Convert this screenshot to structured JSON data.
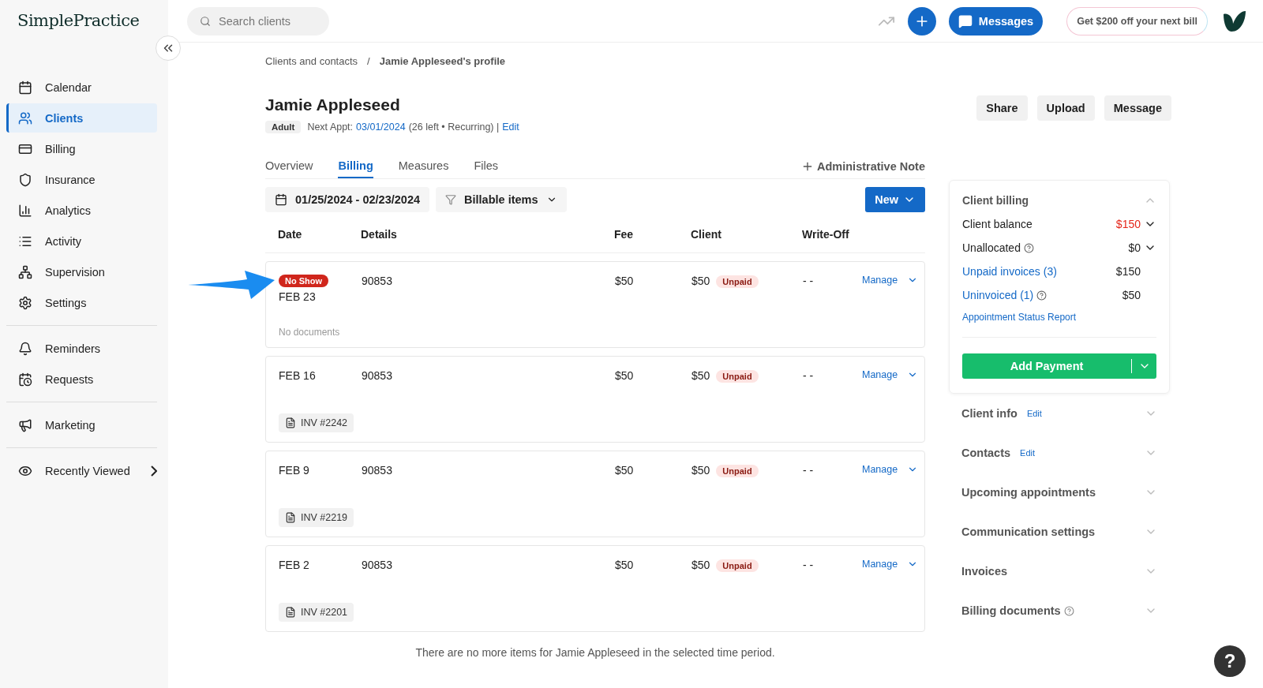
{
  "logo": "SimplePractice",
  "search": {
    "placeholder": "Search clients"
  },
  "header": {
    "messages": "Messages",
    "promo": "Get $200 off your next bill"
  },
  "sidebar": {
    "groups": [
      {
        "items": [
          {
            "label": "Calendar",
            "selected": false,
            "kind": "link"
          },
          {
            "label": "Clients",
            "selected": true,
            "kind": "link"
          },
          {
            "label": "Billing",
            "selected": false,
            "kind": "link"
          },
          {
            "label": "Insurance",
            "selected": false,
            "kind": "link"
          },
          {
            "label": "Analytics",
            "selected": false,
            "kind": "link"
          },
          {
            "label": "Activity",
            "selected": false,
            "kind": "link"
          },
          {
            "label": "Supervision",
            "selected": false,
            "kind": "link"
          },
          {
            "label": "Settings",
            "selected": false,
            "kind": "link"
          }
        ]
      },
      {
        "items": [
          {
            "label": "Reminders",
            "selected": false,
            "kind": "link"
          },
          {
            "label": "Requests",
            "selected": false,
            "kind": "link"
          }
        ]
      },
      {
        "items": [
          {
            "label": "Marketing",
            "selected": false,
            "kind": "link"
          }
        ]
      },
      {
        "items": [
          {
            "label": "Recently Viewed",
            "selected": false,
            "kind": "expand"
          }
        ]
      }
    ]
  },
  "breadcrumb": {
    "items": [
      "Clients and contacts",
      "Jamie Appleseed's profile"
    ],
    "separator": "/"
  },
  "client": {
    "name": "Jamie Appleseed",
    "tag": "Adult",
    "next_label": "Next Appt:",
    "next_date": "03/01/2024",
    "next_info": "(26 left • Recurring) |",
    "edit": "Edit"
  },
  "actions": [
    "Share",
    "Upload",
    "Message"
  ],
  "tabs": [
    {
      "label": "Overview",
      "selected": false
    },
    {
      "label": "Billing",
      "selected": true
    },
    {
      "label": "Measures",
      "selected": false
    },
    {
      "label": "Files",
      "selected": false
    }
  ],
  "admin_note": "Administrative Note",
  "toolbar": {
    "date_range": "01/25/2024 - 02/23/2024",
    "filter": "Billable items",
    "new": "New"
  },
  "table": {
    "columns": [
      "Date",
      "Details",
      "Fee",
      "Client",
      "Write-Off"
    ],
    "rows": [
      {
        "badge": "No Show",
        "date": "FEB 23",
        "details": "90853",
        "fee": "$50",
        "client": "$50",
        "status": "Unpaid",
        "write_off": "- -",
        "manage": "Manage",
        "document": {
          "kind": "none",
          "text": "No documents"
        }
      },
      {
        "date": "FEB 16",
        "details": "90853",
        "fee": "$50",
        "client": "$50",
        "status": "Unpaid",
        "write_off": "- -",
        "manage": "Manage",
        "document": {
          "kind": "invoice",
          "text": "INV #2242"
        }
      },
      {
        "date": "FEB 9",
        "details": "90853",
        "fee": "$50",
        "client": "$50",
        "status": "Unpaid",
        "write_off": "- -",
        "manage": "Manage",
        "document": {
          "kind": "invoice",
          "text": "INV #2219"
        }
      },
      {
        "date": "FEB 2",
        "details": "90853",
        "fee": "$50",
        "client": "$50",
        "status": "Unpaid",
        "write_off": "- -",
        "manage": "Manage",
        "document": {
          "kind": "invoice",
          "text": "INV #2201"
        }
      }
    ],
    "footer": "There are no more items for Jamie Appleseed in the selected time period."
  },
  "billing": {
    "title": "Client billing",
    "expanded": true,
    "rows": [
      {
        "label": "Client balance",
        "value": "$150",
        "kind": "plain",
        "help": false,
        "dropdown": true,
        "alert": true
      },
      {
        "label": "Unallocated",
        "value": "$0",
        "kind": "plain",
        "help": true,
        "dropdown": true,
        "alert": false
      },
      {
        "label": "Unpaid invoices (3)",
        "value": "$150",
        "kind": "link",
        "help": false,
        "dropdown": false,
        "alert": false
      },
      {
        "label": "Uninvoiced (1)",
        "value": "$50",
        "kind": "link",
        "help": true,
        "dropdown": false,
        "alert": false
      }
    ],
    "report": "Appointment Status Report",
    "add_payment": "Add Payment"
  },
  "sections": [
    {
      "title": "Client info",
      "edit": "Edit",
      "help": false
    },
    {
      "title": "Contacts",
      "edit": "Edit",
      "help": false
    },
    {
      "title": "Upcoming appointments",
      "help": false
    },
    {
      "title": "Communication settings",
      "help": false
    },
    {
      "title": "Invoices",
      "help": false
    },
    {
      "title": "Billing documents",
      "help": true
    }
  ],
  "help_button": "?"
}
